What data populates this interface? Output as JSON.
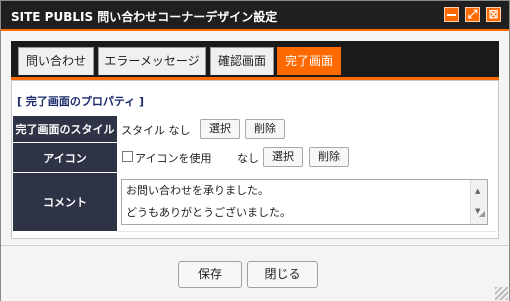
{
  "window": {
    "title": "SITE PUBLIS 問い合わせコーナーデザイン設定",
    "min_label": "",
    "max_label": "⤢",
    "close_label": "⊠",
    "accent": "#ff6a00",
    "titlebar_bg": "#1f1f1f"
  },
  "tabs": [
    {
      "label": "問い合わせ",
      "active": false
    },
    {
      "label": "エラーメッセージ",
      "active": false
    },
    {
      "label": "確認画面",
      "active": false
    },
    {
      "label": "完了画面",
      "active": true
    }
  ],
  "section": {
    "title": "[ 完了画面のプロパティ ]"
  },
  "rows": {
    "style": {
      "label": "完了画面のスタイル",
      "value": "スタイル なし",
      "select_label": "選択",
      "delete_label": "削除"
    },
    "icon": {
      "label": "アイコン",
      "checkbox_label": "アイコンを使用",
      "checked": false,
      "value": "なし",
      "select_label": "選択",
      "delete_label": "削除"
    },
    "comment": {
      "label": "コメント",
      "lines": [
        "お問い合わせを承りました。",
        "",
        "どうもありがとうございました。"
      ]
    }
  },
  "footer": {
    "save_label": "保存",
    "close_label": "閉じる"
  }
}
